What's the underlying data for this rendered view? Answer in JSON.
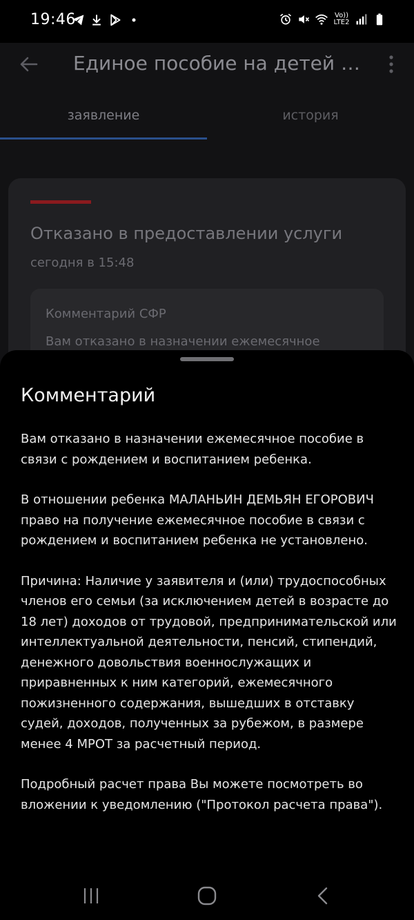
{
  "status_bar": {
    "time": "19:46",
    "lte_label": "Vo)) LTE2",
    "icons": [
      "telegram-icon",
      "download-icon",
      "play-icon",
      "dot-icon",
      "alarm-icon",
      "mute-icon",
      "wifi-icon",
      "signal-icon",
      "battery-icon"
    ]
  },
  "app_bar": {
    "title": "Единое пособие на детей и б..."
  },
  "tabs": [
    {
      "label": "заявление",
      "selected": true
    },
    {
      "label": "история",
      "selected": false
    }
  ],
  "colors": {
    "accent_tab": "#2a4f8c",
    "status_rejected": "#8a1a1e"
  },
  "status_card": {
    "title": "Отказано в предоставлении услуги",
    "time": "сегодня в 15:48",
    "comment_label": "Комментарий СФР",
    "comment_preview": "Вам отказано в назначении ежемесячное"
  },
  "sheet": {
    "title": "Комментарий",
    "paragraphs": [
      "Вам отказано в назначении ежемесячное пособие в связи с рождением и воспитанием ребенка.",
      "В отношении ребенка МАЛАНЬИН ДЕМЬЯН ЕГОРОВИЧ право на получение ежемесячное пособие в связи с рождением и воспитанием ребенка не установлено.",
      "Причина: Наличие у заявителя и (или) трудоспособных членов его семьи (за исключением детей в возрасте до 18 лет) доходов от трудовой, предпринимательской или интеллектуальной деятельности, пенсий, стипендий, денежного довольствия военнослужащих и приравненных к ним категорий, ежемесячного пожизненного содержания, вышедших в отставку судей, доходов, полученных за рубежом, в размере менее 4 МРОТ за расчетный период.",
      "Подробный расчет права Вы можете посмотреть во вложении к уведомлению (\"Протокол расчета права\")."
    ]
  },
  "nav": [
    "recent-apps-icon",
    "home-icon",
    "back-icon"
  ]
}
